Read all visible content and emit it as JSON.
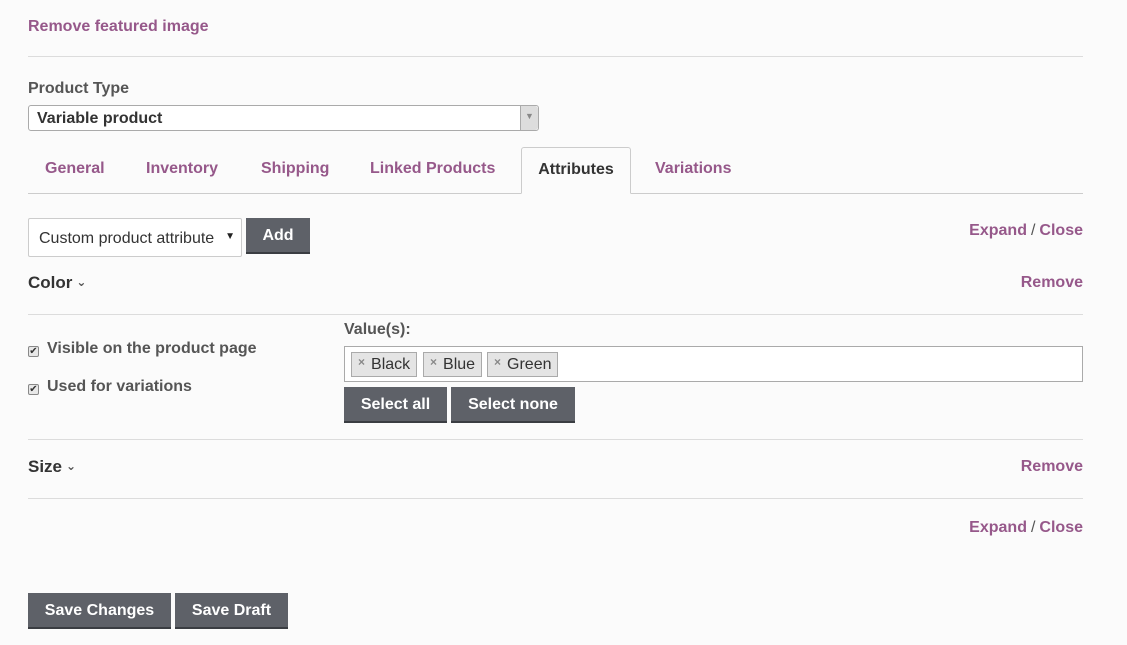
{
  "featured": {
    "remove_label": "Remove featured image"
  },
  "product_type": {
    "label": "Product Type",
    "selected": "Variable product"
  },
  "tabs": [
    {
      "label": "General"
    },
    {
      "label": "Inventory"
    },
    {
      "label": "Shipping"
    },
    {
      "label": "Linked Products"
    },
    {
      "label": "Attributes"
    },
    {
      "label": "Variations"
    }
  ],
  "active_tab": "Attributes",
  "attribute_picker": {
    "selected": "Custom product attribute",
    "add_label": "Add"
  },
  "expand_close": {
    "expand": "Expand",
    "separator": "/",
    "close": "Close"
  },
  "attributes": [
    {
      "name": "Color",
      "remove_label": "Remove",
      "visible_label": "Visible on the product page",
      "visible_checked": true,
      "variations_label": "Used for variations",
      "variations_checked": true,
      "values_label": "Value(s):",
      "values": [
        "Black",
        "Blue",
        "Green"
      ],
      "select_all_label": "Select all",
      "select_none_label": "Select none"
    },
    {
      "name": "Size",
      "remove_label": "Remove"
    }
  ],
  "icons": {
    "chip_remove": "×",
    "chevron": "⌄",
    "check": "✔",
    "caret": "▼"
  },
  "colors": {
    "accent": "#96588a",
    "button": "#5e6168"
  },
  "footer": {
    "save_changes": "Save Changes",
    "save_draft": "Save Draft"
  }
}
